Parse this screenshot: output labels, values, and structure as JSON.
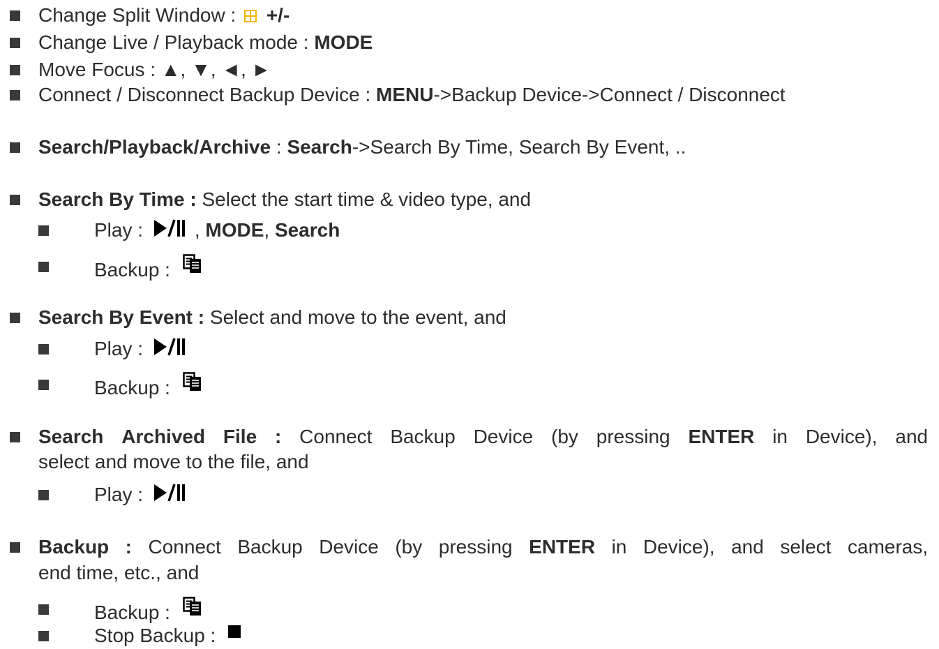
{
  "l1": {
    "label": "Change Split Window : ",
    "key": "+/-",
    "icon": "split-window-icon",
    "icon_color": "#f3b400"
  },
  "l2": {
    "label": "Change Live / Playback mode : ",
    "key": "MODE"
  },
  "l3": {
    "label": "Move Focus : ▲, ▼, ◄, ►"
  },
  "l4": {
    "label": "Connect / Disconnect Backup Device : ",
    "key": "MENU",
    "rest": "->Backup Device->Connect / Disconnect"
  },
  "l5": {
    "head": "Search/Playback/Archive",
    "sep": " : ",
    "key": "Search",
    "rest": "->Search By Time, Search By Event, .."
  },
  "l6": {
    "head": "Search By Time :",
    "rest": " Select the start time & video type, and"
  },
  "l6a": {
    "label": "Play : ",
    "sep1": ", ",
    "key1": "MODE",
    "sep2": ", ",
    "key2": "Search",
    "icon": "play-pause-icon"
  },
  "l6b": {
    "label": "Backup : ",
    "icon": "backup-icon"
  },
  "l7": {
    "head": "Search By Event :",
    "rest": " Select and move to the event, and"
  },
  "l7a": {
    "label": "Play : ",
    "icon": "play-pause-icon"
  },
  "l7b": {
    "label": "Backup : ",
    "icon": "backup-icon"
  },
  "l8": {
    "words": [
      "Search",
      "Archived",
      "File",
      ":",
      "Connect",
      "Backup",
      "Device",
      "(by",
      "pressing",
      "ENTER",
      "in",
      "Device),",
      "and"
    ],
    "cont": "select and move to the file, and"
  },
  "l8a": {
    "label": "Play : ",
    "icon": "play-pause-icon"
  },
  "l9": {
    "words": [
      "Backup",
      ":",
      "Connect",
      "Backup",
      "Device",
      "(by",
      "pressing",
      "ENTER",
      "in",
      "Device),",
      "and",
      "select",
      "cameras,"
    ],
    "cont": "end time, etc., and"
  },
  "l9a": {
    "label": "Backup : ",
    "icon": "backup-icon"
  },
  "l9b": {
    "label": "Stop Backup : ",
    "icon": "stop-icon"
  }
}
